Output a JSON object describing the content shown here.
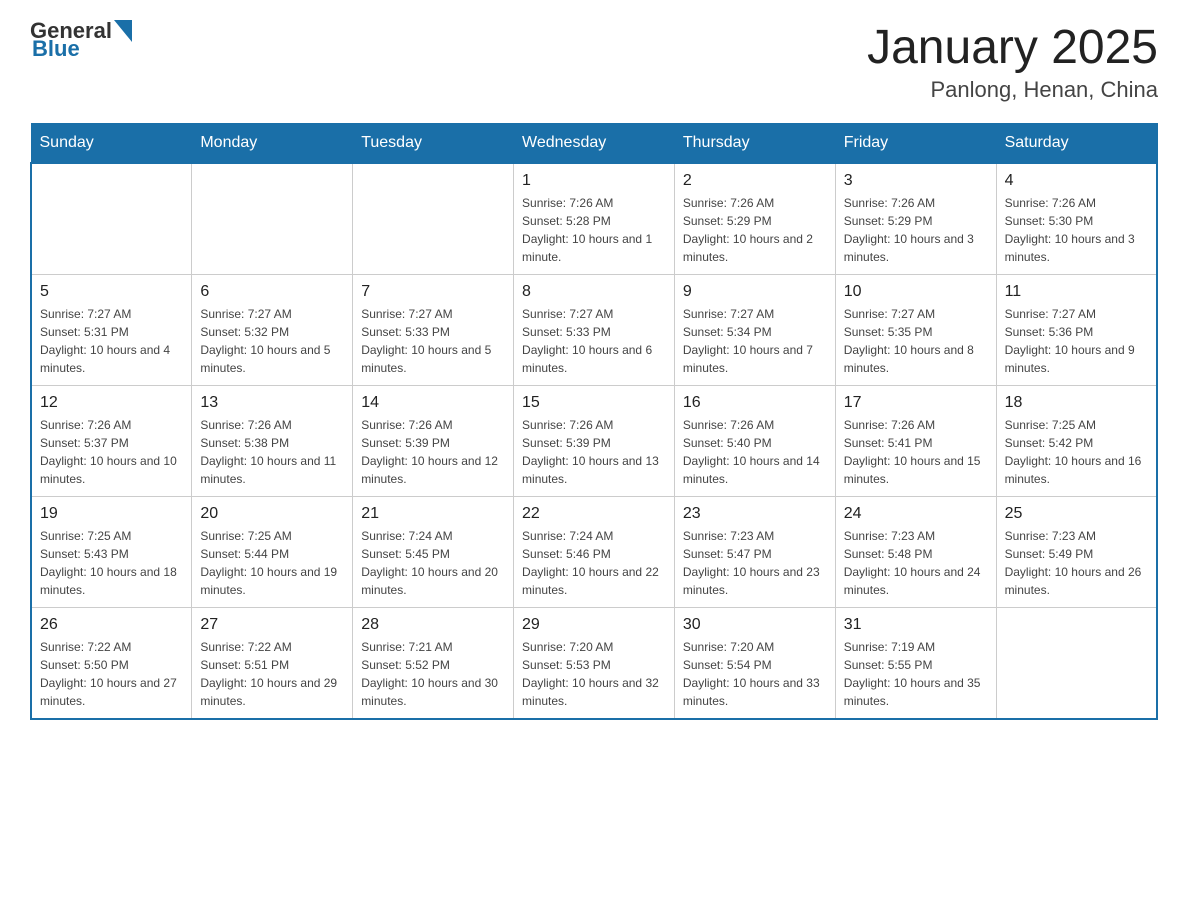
{
  "header": {
    "logo": {
      "general": "General",
      "blue": "Blue"
    },
    "title": "January 2025",
    "subtitle": "Panlong, Henan, China"
  },
  "days_of_week": [
    "Sunday",
    "Monday",
    "Tuesday",
    "Wednesday",
    "Thursday",
    "Friday",
    "Saturday"
  ],
  "weeks": [
    [
      {
        "day": "",
        "info": ""
      },
      {
        "day": "",
        "info": ""
      },
      {
        "day": "",
        "info": ""
      },
      {
        "day": "1",
        "info": "Sunrise: 7:26 AM\nSunset: 5:28 PM\nDaylight: 10 hours and 1 minute."
      },
      {
        "day": "2",
        "info": "Sunrise: 7:26 AM\nSunset: 5:29 PM\nDaylight: 10 hours and 2 minutes."
      },
      {
        "day": "3",
        "info": "Sunrise: 7:26 AM\nSunset: 5:29 PM\nDaylight: 10 hours and 3 minutes."
      },
      {
        "day": "4",
        "info": "Sunrise: 7:26 AM\nSunset: 5:30 PM\nDaylight: 10 hours and 3 minutes."
      }
    ],
    [
      {
        "day": "5",
        "info": "Sunrise: 7:27 AM\nSunset: 5:31 PM\nDaylight: 10 hours and 4 minutes."
      },
      {
        "day": "6",
        "info": "Sunrise: 7:27 AM\nSunset: 5:32 PM\nDaylight: 10 hours and 5 minutes."
      },
      {
        "day": "7",
        "info": "Sunrise: 7:27 AM\nSunset: 5:33 PM\nDaylight: 10 hours and 5 minutes."
      },
      {
        "day": "8",
        "info": "Sunrise: 7:27 AM\nSunset: 5:33 PM\nDaylight: 10 hours and 6 minutes."
      },
      {
        "day": "9",
        "info": "Sunrise: 7:27 AM\nSunset: 5:34 PM\nDaylight: 10 hours and 7 minutes."
      },
      {
        "day": "10",
        "info": "Sunrise: 7:27 AM\nSunset: 5:35 PM\nDaylight: 10 hours and 8 minutes."
      },
      {
        "day": "11",
        "info": "Sunrise: 7:27 AM\nSunset: 5:36 PM\nDaylight: 10 hours and 9 minutes."
      }
    ],
    [
      {
        "day": "12",
        "info": "Sunrise: 7:26 AM\nSunset: 5:37 PM\nDaylight: 10 hours and 10 minutes."
      },
      {
        "day": "13",
        "info": "Sunrise: 7:26 AM\nSunset: 5:38 PM\nDaylight: 10 hours and 11 minutes."
      },
      {
        "day": "14",
        "info": "Sunrise: 7:26 AM\nSunset: 5:39 PM\nDaylight: 10 hours and 12 minutes."
      },
      {
        "day": "15",
        "info": "Sunrise: 7:26 AM\nSunset: 5:39 PM\nDaylight: 10 hours and 13 minutes."
      },
      {
        "day": "16",
        "info": "Sunrise: 7:26 AM\nSunset: 5:40 PM\nDaylight: 10 hours and 14 minutes."
      },
      {
        "day": "17",
        "info": "Sunrise: 7:26 AM\nSunset: 5:41 PM\nDaylight: 10 hours and 15 minutes."
      },
      {
        "day": "18",
        "info": "Sunrise: 7:25 AM\nSunset: 5:42 PM\nDaylight: 10 hours and 16 minutes."
      }
    ],
    [
      {
        "day": "19",
        "info": "Sunrise: 7:25 AM\nSunset: 5:43 PM\nDaylight: 10 hours and 18 minutes."
      },
      {
        "day": "20",
        "info": "Sunrise: 7:25 AM\nSunset: 5:44 PM\nDaylight: 10 hours and 19 minutes."
      },
      {
        "day": "21",
        "info": "Sunrise: 7:24 AM\nSunset: 5:45 PM\nDaylight: 10 hours and 20 minutes."
      },
      {
        "day": "22",
        "info": "Sunrise: 7:24 AM\nSunset: 5:46 PM\nDaylight: 10 hours and 22 minutes."
      },
      {
        "day": "23",
        "info": "Sunrise: 7:23 AM\nSunset: 5:47 PM\nDaylight: 10 hours and 23 minutes."
      },
      {
        "day": "24",
        "info": "Sunrise: 7:23 AM\nSunset: 5:48 PM\nDaylight: 10 hours and 24 minutes."
      },
      {
        "day": "25",
        "info": "Sunrise: 7:23 AM\nSunset: 5:49 PM\nDaylight: 10 hours and 26 minutes."
      }
    ],
    [
      {
        "day": "26",
        "info": "Sunrise: 7:22 AM\nSunset: 5:50 PM\nDaylight: 10 hours and 27 minutes."
      },
      {
        "day": "27",
        "info": "Sunrise: 7:22 AM\nSunset: 5:51 PM\nDaylight: 10 hours and 29 minutes."
      },
      {
        "day": "28",
        "info": "Sunrise: 7:21 AM\nSunset: 5:52 PM\nDaylight: 10 hours and 30 minutes."
      },
      {
        "day": "29",
        "info": "Sunrise: 7:20 AM\nSunset: 5:53 PM\nDaylight: 10 hours and 32 minutes."
      },
      {
        "day": "30",
        "info": "Sunrise: 7:20 AM\nSunset: 5:54 PM\nDaylight: 10 hours and 33 minutes."
      },
      {
        "day": "31",
        "info": "Sunrise: 7:19 AM\nSunset: 5:55 PM\nDaylight: 10 hours and 35 minutes."
      },
      {
        "day": "",
        "info": ""
      }
    ]
  ]
}
